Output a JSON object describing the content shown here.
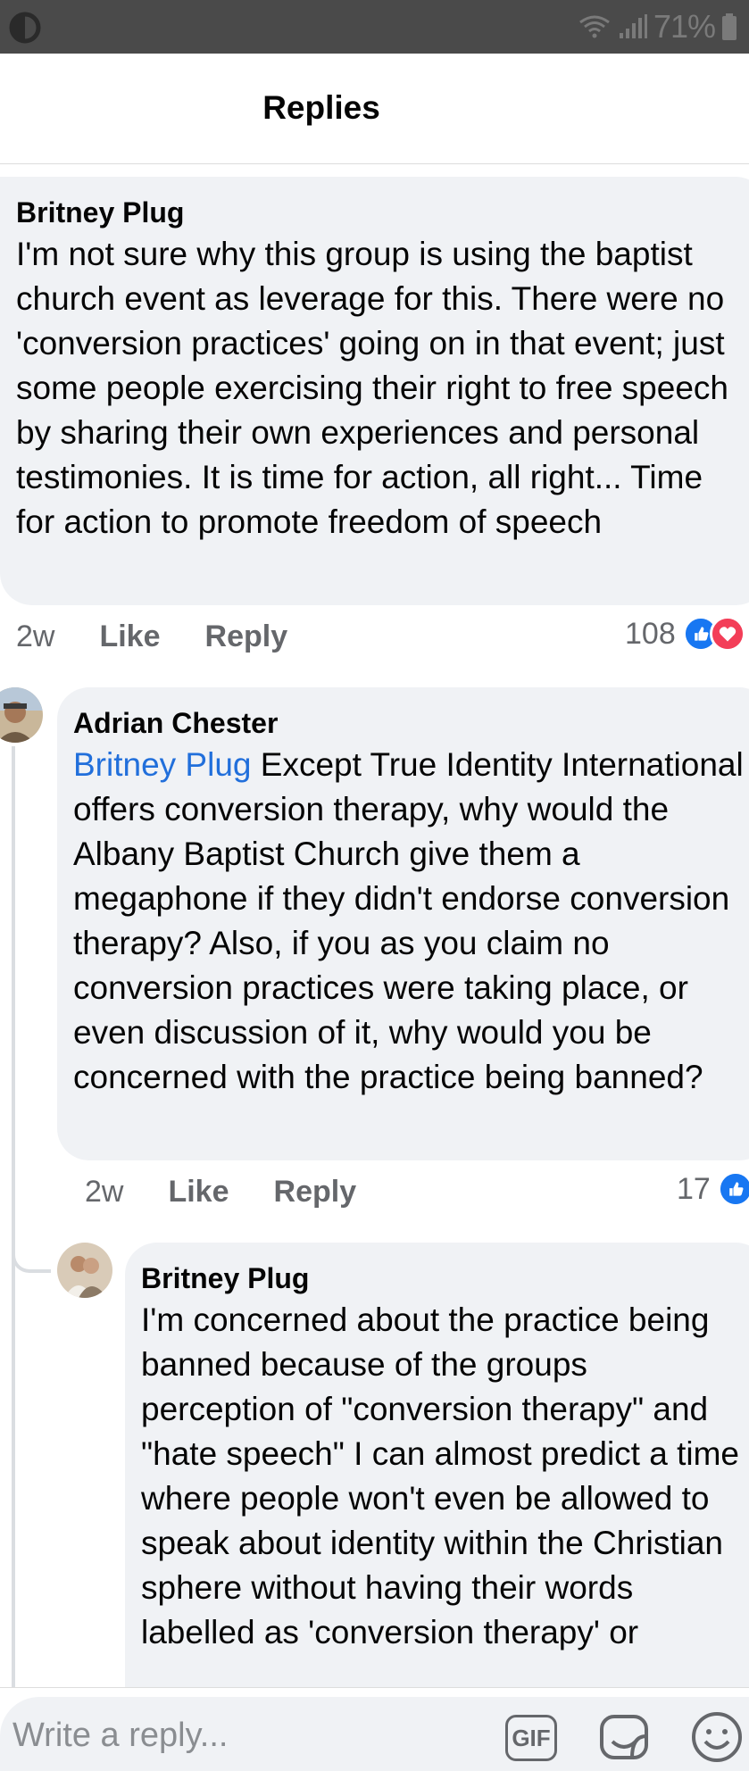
{
  "status_bar": {
    "battery_text": "71%",
    "icons": [
      "wifi-icon",
      "signal-icon",
      "battery-icon"
    ]
  },
  "header": {
    "title": "Replies"
  },
  "comments": [
    {
      "author": "Britney Plug",
      "text": "I'm not sure why this group is using the baptist church event as leverage for this. There were no 'conversion practices' going on in that event; just some people exercising their right to free speech by sharing their own experiences and personal testimonies. It is time for action, all right... Time for action to promote freedom of speech",
      "time": "2w",
      "like_label": "Like",
      "reply_label": "Reply",
      "reaction_count": "108"
    },
    {
      "author": "Adrian Chester",
      "mention": "Britney Plug",
      "text": " Except True Identity International offers conversion therapy, why would the Albany Baptist Church give them a megaphone if they didn't endorse conversion therapy? Also, if you as you claim no conversion practices were taking place, or even discussion of it, why would you be concerned with the practice being banned?",
      "time": "2w",
      "like_label": "Like",
      "reply_label": "Reply",
      "reaction_count": "17"
    },
    {
      "author": "Britney Plug",
      "text": "I'm concerned about the practice being banned because of the groups perception of \"conversion therapy\" and \"hate speech\" I can almost predict a time where people won't even be allowed to speak about identity within the Christian sphere without having their words labelled as 'conversion therapy' or"
    }
  ],
  "reply_bar": {
    "placeholder": "Write a reply...",
    "gif_label": "GIF"
  },
  "colors": {
    "status_bar_bg": "#4a4a4a",
    "bubble_bg": "#f0f2f5",
    "mention": "#216fdb",
    "like_blue": "#1877f2",
    "love_red": "#f33e58",
    "meta_text": "#65676b"
  }
}
